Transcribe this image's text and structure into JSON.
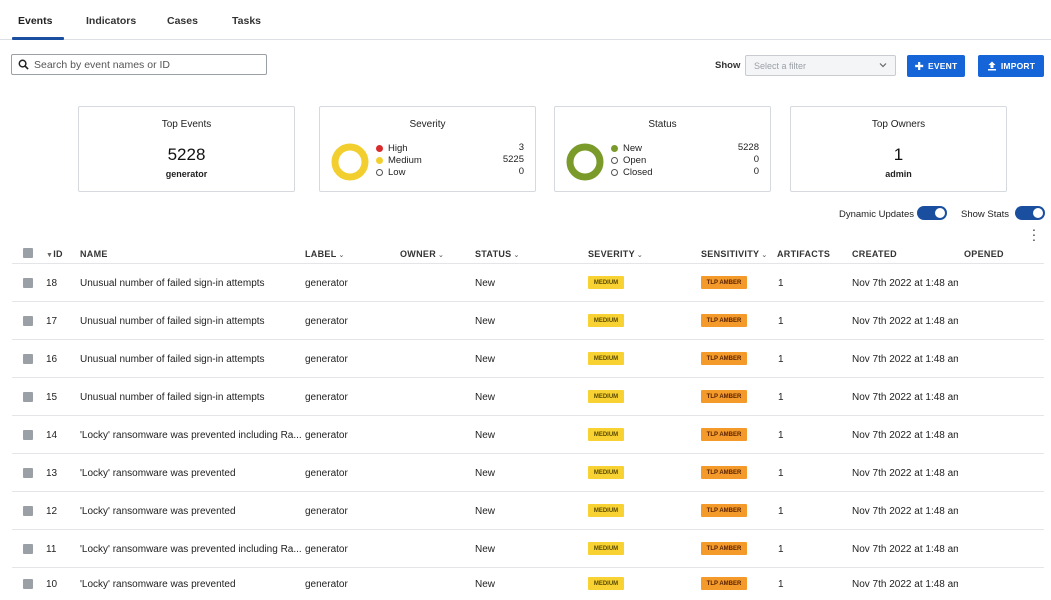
{
  "tabs": [
    {
      "label": "Events"
    },
    {
      "label": "Indicators"
    },
    {
      "label": "Cases"
    },
    {
      "label": "Tasks"
    }
  ],
  "toolbar": {
    "search_placeholder": "Search by event names or ID",
    "show_label": "Show",
    "filter_placeholder": "Select a filter",
    "event_button": "EVENT",
    "import_button": "IMPORT"
  },
  "stats": {
    "top_events": {
      "title": "Top Events",
      "value": "5228",
      "sub": "generator"
    },
    "severity": {
      "title": "Severity",
      "items": [
        {
          "label": "High",
          "count": "3",
          "color": "#d92b2b"
        },
        {
          "label": "Medium",
          "count": "5225",
          "color": "#f2cf2e"
        },
        {
          "label": "Low",
          "count": "0",
          "color": "hollow"
        }
      ]
    },
    "status": {
      "title": "Status",
      "items": [
        {
          "label": "New",
          "count": "5228",
          "color": "#7a9a2a"
        },
        {
          "label": "Open",
          "count": "0",
          "color": "hollow"
        },
        {
          "label": "Closed",
          "count": "0",
          "color": "hollow"
        }
      ]
    },
    "top_owners": {
      "title": "Top Owners",
      "value": "1",
      "sub": "admin"
    }
  },
  "toggles": {
    "dynamic_updates": "Dynamic Updates",
    "show_stats": "Show Stats"
  },
  "table": {
    "headers": {
      "id": "ID",
      "name": "NAME",
      "label": "LABEL",
      "owner": "OWNER",
      "status": "STATUS",
      "severity": "SEVERITY",
      "sensitivity": "SENSITIVITY",
      "artifacts": "ARTIFACTS",
      "created": "CREATED",
      "opened": "OPENED"
    },
    "rows": [
      {
        "id": "18",
        "name": "Unusual number of failed sign-in attempts",
        "label": "generator",
        "status": "New",
        "severity": "MEDIUM",
        "sensitivity": "TLP AMBER",
        "artifacts": "1",
        "created": "Nov 7th 2022 at 1:48 am"
      },
      {
        "id": "17",
        "name": "Unusual number of failed sign-in attempts",
        "label": "generator",
        "status": "New",
        "severity": "MEDIUM",
        "sensitivity": "TLP AMBER",
        "artifacts": "1",
        "created": "Nov 7th 2022 at 1:48 am"
      },
      {
        "id": "16",
        "name": "Unusual number of failed sign-in attempts",
        "label": "generator",
        "status": "New",
        "severity": "MEDIUM",
        "sensitivity": "TLP AMBER",
        "artifacts": "1",
        "created": "Nov 7th 2022 at 1:48 am"
      },
      {
        "id": "15",
        "name": "Unusual number of failed sign-in attempts",
        "label": "generator",
        "status": "New",
        "severity": "MEDIUM",
        "sensitivity": "TLP AMBER",
        "artifacts": "1",
        "created": "Nov 7th 2022 at 1:48 am"
      },
      {
        "id": "14",
        "name": "'Locky' ransomware was prevented including Ra...",
        "label": "generator",
        "status": "New",
        "severity": "MEDIUM",
        "sensitivity": "TLP AMBER",
        "artifacts": "1",
        "created": "Nov 7th 2022 at 1:48 am"
      },
      {
        "id": "13",
        "name": "'Locky' ransomware was prevented",
        "label": "generator",
        "status": "New",
        "severity": "MEDIUM",
        "sensitivity": "TLP AMBER",
        "artifacts": "1",
        "created": "Nov 7th 2022 at 1:48 am"
      },
      {
        "id": "12",
        "name": "'Locky' ransomware was prevented",
        "label": "generator",
        "status": "New",
        "severity": "MEDIUM",
        "sensitivity": "TLP AMBER",
        "artifacts": "1",
        "created": "Nov 7th 2022 at 1:48 am"
      },
      {
        "id": "11",
        "name": "'Locky' ransomware was prevented including Ra...",
        "label": "generator",
        "status": "New",
        "severity": "MEDIUM",
        "sensitivity": "TLP AMBER",
        "artifacts": "1",
        "created": "Nov 7th 2022 at 1:48 am"
      },
      {
        "id": "10",
        "name": "'Locky' ransomware was prevented",
        "label": "generator",
        "status": "New",
        "severity": "MEDIUM",
        "sensitivity": "TLP AMBER",
        "artifacts": "1",
        "created": "Nov 7th 2022 at 1:48 am"
      }
    ]
  },
  "colors": {
    "accent": "#1565d8",
    "toggle": "#1a4fa0",
    "severity_donut": "#f2cf2e",
    "status_donut": "#7a9a2a",
    "badge_medium": "#f7d232",
    "badge_tlp_amber": "#f39a2b"
  }
}
